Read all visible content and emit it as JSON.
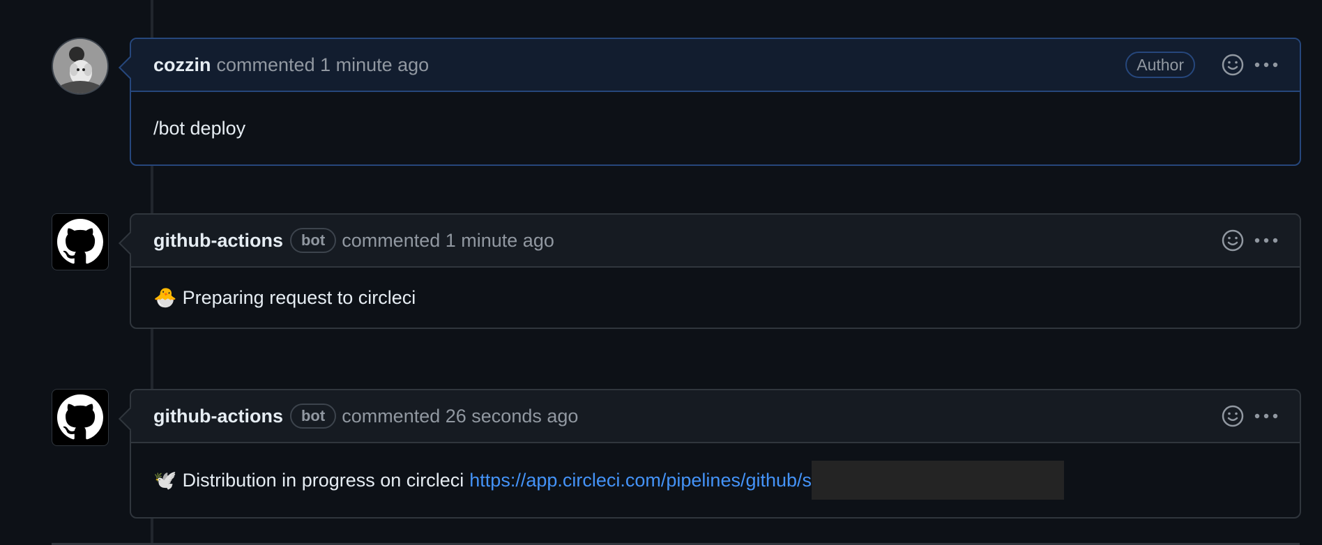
{
  "comments": [
    {
      "author": "cozzin",
      "badge": "",
      "action": "commented 1 minute ago",
      "role_badge": "Author",
      "body": "/bot deploy",
      "emoji": "",
      "link": ""
    },
    {
      "author": "github-actions",
      "badge": "bot",
      "action": "commented 1 minute ago",
      "role_badge": "",
      "body": "Preparing request to circleci",
      "emoji": "🐣",
      "link": ""
    },
    {
      "author": "github-actions",
      "badge": "bot",
      "action": "commented 26 seconds ago",
      "role_badge": "",
      "body": "Distribution in progress on circleci",
      "emoji": "🕊️",
      "link": "https://app.circleci.com/pipelines/github/s"
    }
  ],
  "icons": {
    "reaction": "smiley-icon",
    "more": "kebab-horizontal-icon",
    "bot_avatar": "github-mark-icon"
  },
  "colors": {
    "background": "#0d1117",
    "header": "#161b22",
    "highlight_border": "#26477c",
    "link": "#4493f8",
    "muted": "#9198a1"
  }
}
